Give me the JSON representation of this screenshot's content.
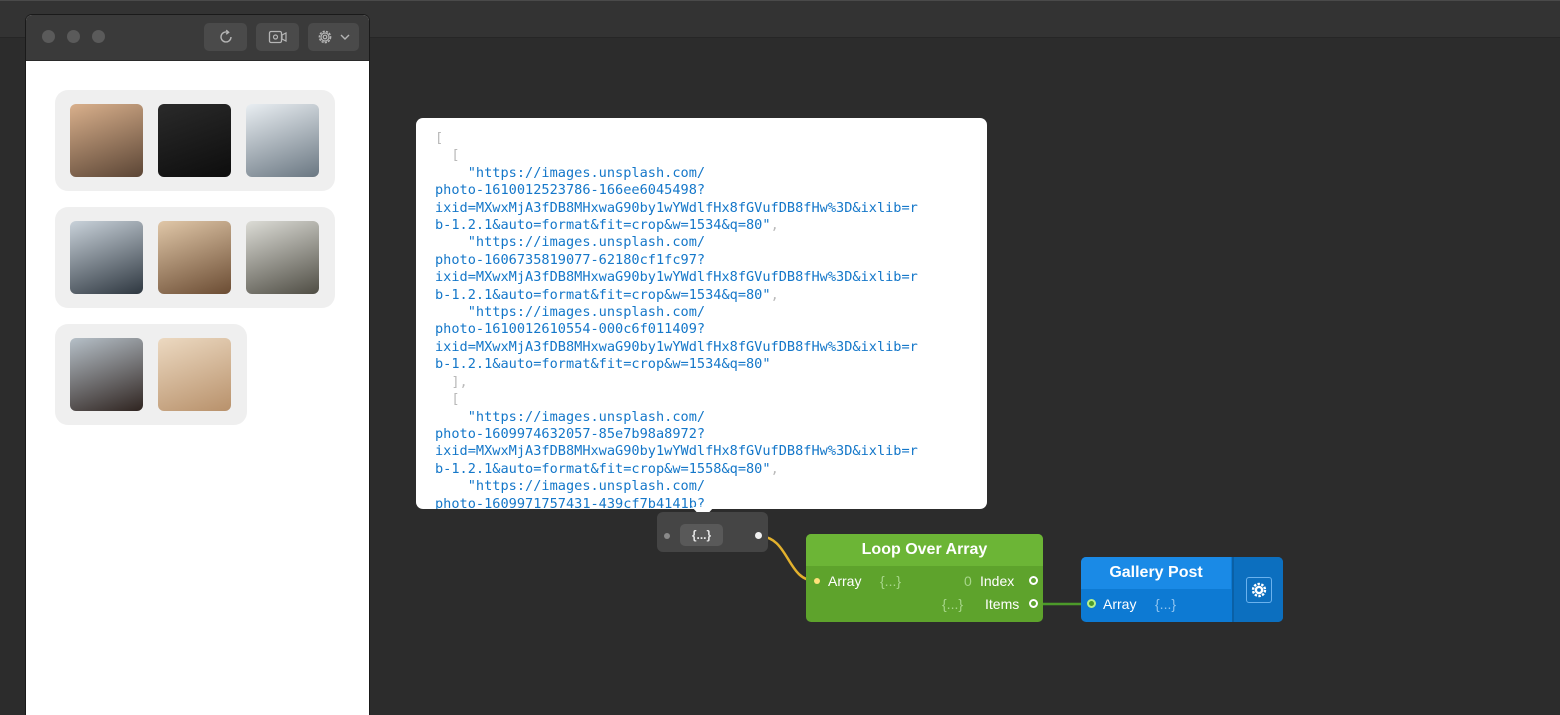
{
  "toolbar": {
    "refresh_icon": "refresh-icon",
    "record_icon": "video-record-icon",
    "settings_icon": "gear-icon",
    "dropdown_icon": "chevron-down-icon"
  },
  "gallery": {
    "cards": [
      {
        "images": [
          {
            "name": "woman-on-street-photo",
            "c1": "#d9b08c",
            "c2": "#5b4535"
          },
          {
            "name": "dark-house-night-photo",
            "c1": "#2a2a2a",
            "c2": "#0d0d0d"
          },
          {
            "name": "snowy-road-photo",
            "c1": "#e9eef2",
            "c2": "#6a7782"
          }
        ]
      },
      {
        "images": [
          {
            "name": "snowy-forest-photo",
            "c1": "#c9d2da",
            "c2": "#2e3740"
          },
          {
            "name": "eiffel-tower-photo",
            "c1": "#e0c7a8",
            "c2": "#6b4c33"
          },
          {
            "name": "round-cabin-photo",
            "c1": "#dcdcd6",
            "c2": "#4f4d44"
          }
        ]
      },
      {
        "images": [
          {
            "name": "snowy-city-street-photo",
            "c1": "#b6c0c8",
            "c2": "#2f2420"
          },
          {
            "name": "dog-on-beach-photo",
            "c1": "#ecd9c1",
            "c2": "#b8916b"
          }
        ]
      }
    ]
  },
  "popover": {
    "lines": [
      {
        "t": "[",
        "p": true
      },
      {
        "t": "  [",
        "p": true
      },
      {
        "t": "    \"https://images.unsplash.com/"
      },
      {
        "t": "photo-1610012523786-166ee6045498?"
      },
      {
        "t": "ixid=MXwxMjA3fDB8MHxwaG90by1wYWdlfHx8fGVufDB8fHw%3D&ixlib=r"
      },
      {
        "t": "b-1.2.1&auto=format&fit=crop&w=1534&q=80\"",
        "s": ","
      },
      {
        "t": "    \"https://images.unsplash.com/"
      },
      {
        "t": "photo-1606735819077-62180cf1fc97?"
      },
      {
        "t": "ixid=MXwxMjA3fDB8MHxwaG90by1wYWdlfHx8fGVufDB8fHw%3D&ixlib=r"
      },
      {
        "t": "b-1.2.1&auto=format&fit=crop&w=1534&q=80\"",
        "s": ","
      },
      {
        "t": "    \"https://images.unsplash.com/"
      },
      {
        "t": "photo-1610012610554-000c6f011409?"
      },
      {
        "t": "ixid=MXwxMjA3fDB8MHxwaG90by1wYWdlfHx8fGVufDB8fHw%3D&ixlib=r"
      },
      {
        "t": "b-1.2.1&auto=format&fit=crop&w=1534&q=80\""
      },
      {
        "t": "  ],",
        "p": true
      },
      {
        "t": "  [",
        "p": true
      },
      {
        "t": "    \"https://images.unsplash.com/"
      },
      {
        "t": "photo-1609974632057-85e7b98a8972?"
      },
      {
        "t": "ixid=MXwxMjA3fDB8MHxwaG90by1wYWdlfHx8fGVufDB8fHw%3D&ixlib=r"
      },
      {
        "t": "b-1.2.1&auto=format&fit=crop&w=1558&q=80\"",
        "s": ","
      },
      {
        "t": "    \"https://images.unsplash.com/"
      },
      {
        "t": "photo-1609971757431-439cf7b4141b?"
      }
    ]
  },
  "object_node": {
    "label": "{...}"
  },
  "loop_node": {
    "title": "Loop Over Array",
    "input_label": "Array",
    "input_value": "{...}",
    "index_value": "0",
    "index_label": "Index",
    "items_value": "{...}",
    "items_label": "Items"
  },
  "gallery_post_node": {
    "title": "Gallery Post",
    "input_label": "Array",
    "input_value": "{...}",
    "settings_icon": "gear-icon"
  },
  "colors": {
    "loop_green": "#5ea32c",
    "gallery_blue": "#0d7ad3",
    "wire_yellow": "#e3b12d",
    "wire_green": "#4c9a2a",
    "json_text": "#1477c9"
  }
}
